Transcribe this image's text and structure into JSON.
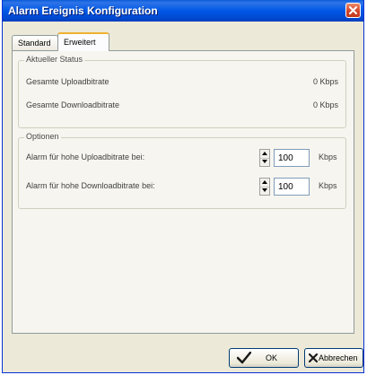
{
  "window": {
    "title": "Alarm Ereignis Konfiguration"
  },
  "tabs": [
    {
      "label": "Standard"
    },
    {
      "label": "Erweitert"
    }
  ],
  "status_group": {
    "title": "Aktueller Status",
    "rows": [
      {
        "label": "Gesamte Uploadbitrate",
        "value": "0 Kbps"
      },
      {
        "label": "Gesamte Downloadbitrate",
        "value": "0 Kbps"
      }
    ]
  },
  "options_group": {
    "title": "Optionen",
    "rows": [
      {
        "label": "Alarm für hohe Uploadbitrate bei:",
        "value": "100",
        "unit": "Kbps"
      },
      {
        "label": "Alarm für hohe Downloadbitrate bei:",
        "value": "100",
        "unit": "Kbps"
      }
    ]
  },
  "buttons": {
    "ok_label": "OK",
    "cancel_label": "Abbrechen"
  },
  "colors": {
    "titlebar": "#0058e6",
    "window_bg": "#ece9d8",
    "close_button": "#d2462a"
  },
  "icons": {
    "close": "close-icon",
    "ok": "checkmark-icon",
    "cancel": "x-icon"
  }
}
